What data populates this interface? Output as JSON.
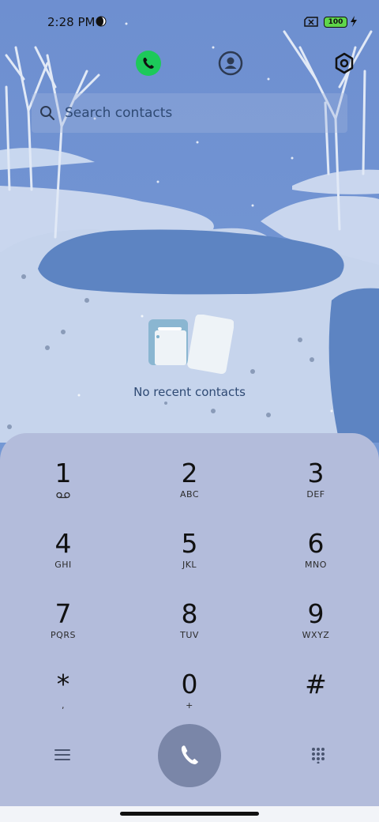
{
  "status_bar": {
    "time": "2:28 PM",
    "battery": "100",
    "icons": [
      "moon-icon",
      "no-sim-icon",
      "battery-icon",
      "charging-icon"
    ]
  },
  "top_bar": {
    "icons": [
      "phone-tab-icon",
      "contacts-tab-icon",
      "settings-icon"
    ],
    "active_color": "#1dc95a"
  },
  "search": {
    "placeholder": "Search contacts"
  },
  "recent": {
    "empty_text": "No recent contacts"
  },
  "dialpad": {
    "keys": [
      {
        "digit": "1",
        "letters": ""
      },
      {
        "digit": "2",
        "letters": "ABC"
      },
      {
        "digit": "3",
        "letters": "DEF"
      },
      {
        "digit": "4",
        "letters": "GHI"
      },
      {
        "digit": "5",
        "letters": "JKL"
      },
      {
        "digit": "6",
        "letters": "MNO"
      },
      {
        "digit": "7",
        "letters": "PQRS"
      },
      {
        "digit": "8",
        "letters": "TUV"
      },
      {
        "digit": "9",
        "letters": "WXYZ"
      },
      {
        "digit": "*",
        "letters": ","
      },
      {
        "digit": "0",
        "letters": "+"
      },
      {
        "digit": "#",
        "letters": ""
      }
    ],
    "bottom_icons": [
      "menu-icon",
      "call-icon",
      "dialpad-icon"
    ],
    "call_button_color": "#7a86a8"
  }
}
